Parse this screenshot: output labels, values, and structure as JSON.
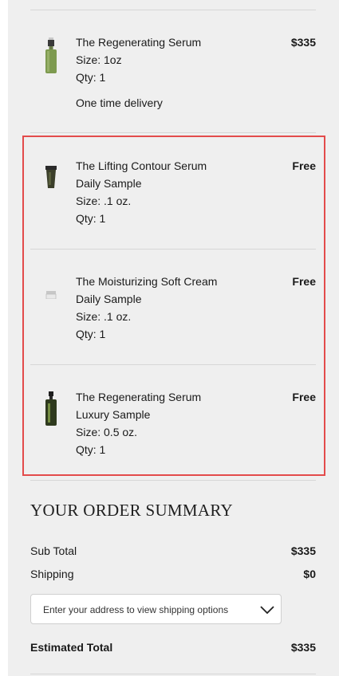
{
  "cart": {
    "items": [
      {
        "name": "The Regenerating Serum",
        "lines": [
          "Size: 1oz",
          "Qty: 1"
        ],
        "delivery": "One time delivery",
        "price": "$335",
        "icon": "serum-bottle-icon"
      },
      {
        "name": "The Lifting Contour Serum",
        "lines": [
          "Daily Sample",
          "Size: .1 oz.",
          "Qty: 1"
        ],
        "price": "Free",
        "icon": "serum-sachet-icon"
      },
      {
        "name": "The Moisturizing Soft Cream",
        "lines": [
          "Daily Sample",
          "Size: .1 oz.",
          "Qty: 1"
        ],
        "price": "Free",
        "icon": "cream-jar-icon"
      },
      {
        "name": "The Regenerating Serum",
        "lines": [
          "Luxury Sample",
          "Size: 0.5 oz.",
          "Qty: 1"
        ],
        "price": "Free",
        "icon": "serum-bottle-icon"
      }
    ]
  },
  "summary": {
    "title": "YOUR ORDER SUMMARY",
    "subtotal_label": "Sub Total",
    "subtotal_value": "$335",
    "shipping_label": "Shipping",
    "shipping_value": "$0",
    "shipping_select_placeholder": "Enter your address to view shipping options",
    "total_label": "Estimated Total",
    "total_value": "$335"
  },
  "colors": {
    "highlight_border": "#e34b4b",
    "panel_background": "#efefef"
  }
}
